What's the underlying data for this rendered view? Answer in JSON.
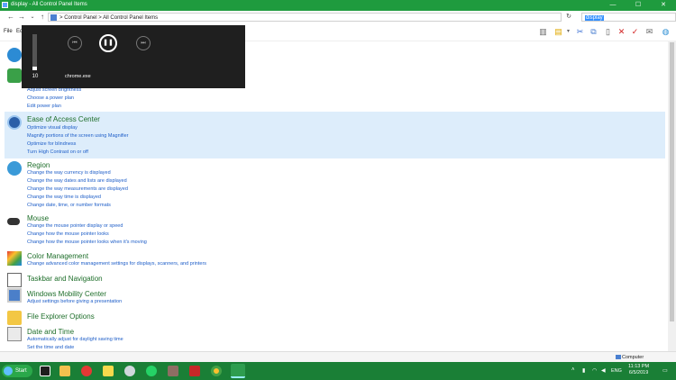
{
  "window": {
    "title": "display - All Control Panel Items",
    "min": "—",
    "max": "☐",
    "close": "✕"
  },
  "address": {
    "path_1": "Control Panel",
    "path_2": "All Control Panel Items",
    "sep": ">",
    "search_value": "display"
  },
  "menu": {
    "file": "File",
    "edit": "Ed"
  },
  "flyout": {
    "volume": "10",
    "volume_level": 0.1,
    "app": "chrome.exe"
  },
  "sections": {
    "power_links": [
      "Adjust screen brightness",
      "Choose a power plan",
      "Edit power plan"
    ],
    "ease": {
      "title": "Ease of Access Center",
      "links": [
        "Optimize visual display",
        "Magnify portions of the screen using Magnifier",
        "Optimize for blindness",
        "Turn High Contrast on or off"
      ]
    },
    "region": {
      "title": "Region",
      "links": [
        "Change the way currency is displayed",
        "Change the way dates and lists are displayed",
        "Change the way measurements are displayed",
        "Change the way time is displayed",
        "Change date, time, or number formats"
      ]
    },
    "mouse": {
      "title": "Mouse",
      "links": [
        "Change the mouse pointer display or speed",
        "Change how the mouse pointer looks",
        "Change how the mouse pointer looks when it's moving"
      ]
    },
    "color": {
      "title": "Color Management",
      "links": [
        "Change advanced color management settings for displays, scanners, and printers"
      ]
    },
    "taskbar": {
      "title": "Taskbar and Navigation"
    },
    "mobility": {
      "title": "Windows Mobility Center",
      "links": [
        "Adjust settings before giving a presentation"
      ]
    },
    "explorer": {
      "title": "File Explorer Options"
    },
    "datetime": {
      "title": "Date and Time",
      "links": [
        "Automatically adjust for daylight saving time",
        "Set the time and date"
      ]
    }
  },
  "status": {
    "computer": "Computer"
  },
  "taskbar": {
    "start": "Start",
    "lang": "ENG",
    "time": "11:13 PM",
    "date": "6/5/2019"
  },
  "colors": {
    "titlebar": "#1f9b3e",
    "taskbar": "#1a7f36",
    "link": "#1e5ec8",
    "category": "#1e6e2a",
    "highlight": "#ddedfb"
  }
}
